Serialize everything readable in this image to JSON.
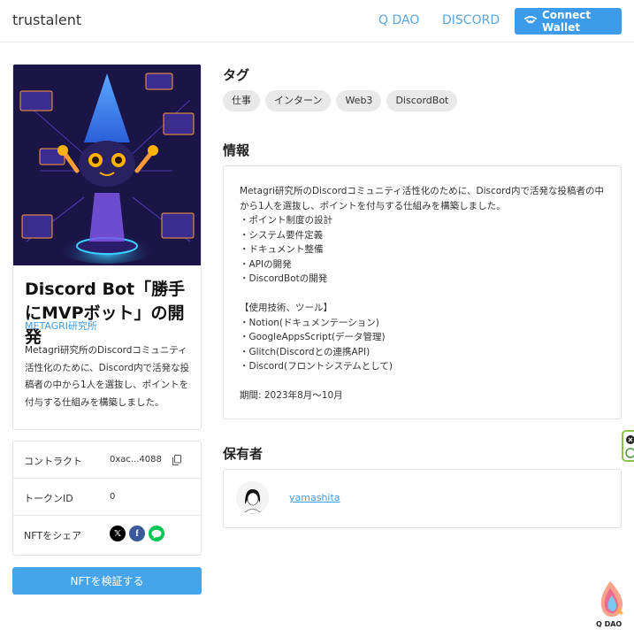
{
  "header": {
    "brand": "trustalent",
    "nav": [
      "Q DAO",
      "DISCORD"
    ],
    "connect_label": "Connect Wallet",
    "connect_icon": "walletconnect-icon"
  },
  "nft": {
    "title": "Discord Bot「勝手にMVPボット」の開発",
    "issuer": "METAGRI研究所",
    "summary": "Metagri研究所のDiscordコミュニティ活性化のために、Discord内で活発な投稿者の中から1人を選抜し、ポイントを付与する仕組みを構築しました。"
  },
  "meta": {
    "contract_label": "コントラクト",
    "contract_value": "0xac...4088",
    "token_label": "トークンID",
    "token_value": "0",
    "share_label": "NFTをシェア",
    "share_icons": [
      "x-icon",
      "facebook-icon",
      "line-icon"
    ]
  },
  "verify_label": "NFTを検証する",
  "tags_section": {
    "heading": "タグ",
    "tags": [
      "仕事",
      "インターン",
      "Web3",
      "DiscordBot"
    ]
  },
  "info_section": {
    "heading": "情報",
    "lines": [
      "Metagri研究所のDiscordコミュニティ活性化のために、Discord内で活発な投稿者の中",
      "から1人を選抜し、ポイントを付与する仕組みを構築しました。",
      "・ポイント制度の設計",
      "・システム要件定義",
      "・ドキュメント整備",
      "・APIの開発",
      "・DiscordBotの開発",
      "",
      "【使用技術、ツール】",
      "・Notion(ドキュメンテーション)",
      "・GoogleAppsScript(データ管理)",
      "・Glitch(Discordとの連携API)",
      "・Discord(フロントシステムとして)",
      "",
      "期間: 2023年8月～10月"
    ]
  },
  "owner_section": {
    "heading": "保有者",
    "name": "yamashita"
  },
  "footer_logo": "Q DAO",
  "colors": {
    "accent": "#3d9be9",
    "x": "#000000",
    "facebook": "#3b5998",
    "line": "#06c755"
  }
}
